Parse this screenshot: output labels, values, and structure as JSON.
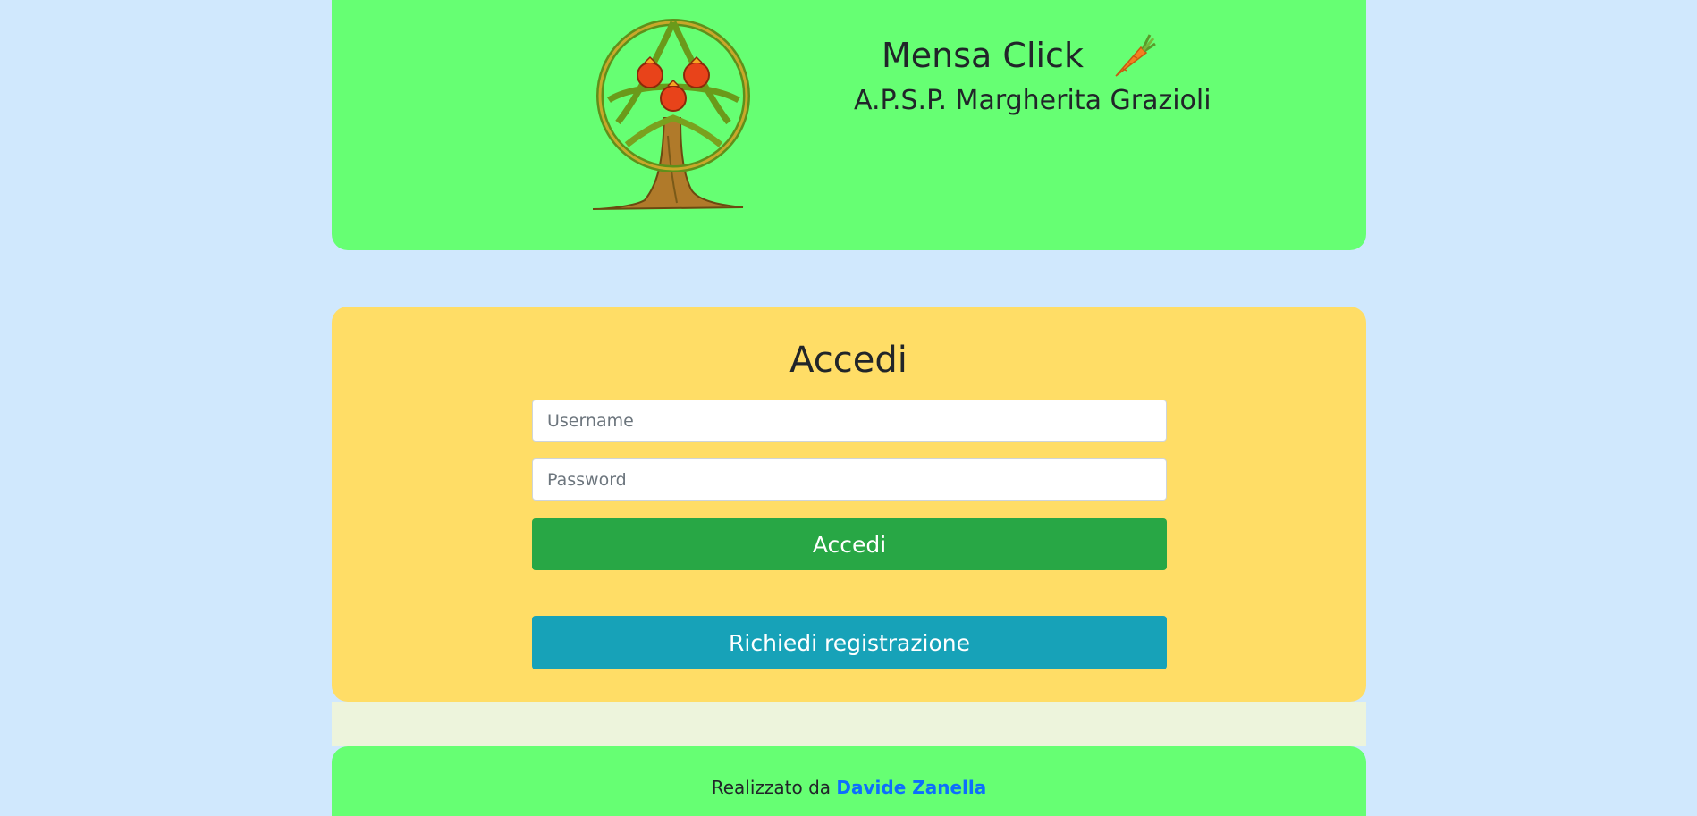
{
  "header": {
    "logo_icon": "tree-with-pomegranates-logo",
    "title": "Mensa Click",
    "title_icon": "carrot-icon",
    "organization": "A.P.S.P. Margherita Grazioli",
    "background": "#66ff73"
  },
  "login": {
    "title": "Accedi",
    "username_placeholder": "Username",
    "username_value": "",
    "password_placeholder": "Password",
    "password_value": "",
    "submit_label": "Accedi",
    "register_label": "Richiedi registrazione",
    "background": "#ffdd66",
    "submit_color": "#28a745",
    "register_color": "#17a2b8"
  },
  "footer": {
    "prefix": "Realizzato da",
    "author": "Davide Zanella",
    "link_color": "#0d6efd"
  },
  "page": {
    "background": "#d0e8fd"
  }
}
